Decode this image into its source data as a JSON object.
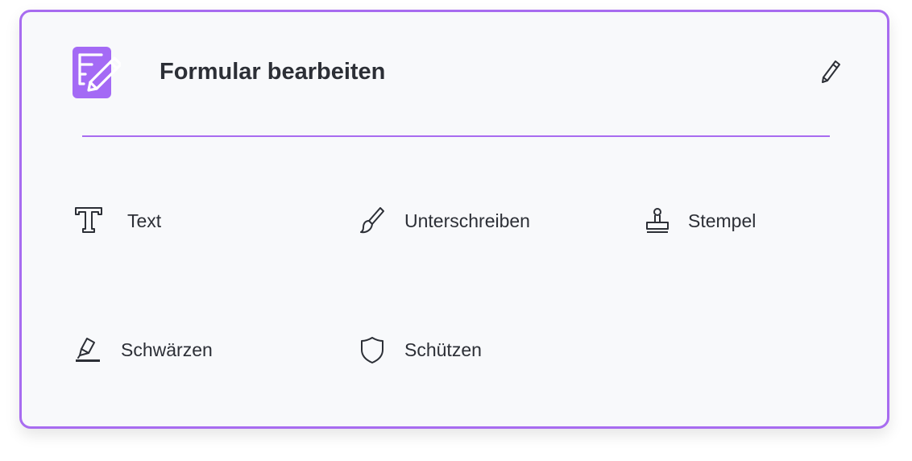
{
  "header": {
    "title": "Formular bearbeiten",
    "app_icon": "form-edit-icon",
    "edit_icon": "pencil-icon"
  },
  "tools": [
    {
      "id": "text",
      "label": "Text",
      "icon": "text-icon"
    },
    {
      "id": "sign",
      "label": "Unterschreiben",
      "icon": "brush-icon"
    },
    {
      "id": "stamp",
      "label": "Stempel",
      "icon": "stamp-icon"
    },
    {
      "id": "redact",
      "label": "Schwärzen",
      "icon": "highlighter-icon"
    },
    {
      "id": "protect",
      "label": "Schützen",
      "icon": "shield-icon"
    }
  ],
  "colors": {
    "accent": "#a86cf0",
    "icon_bg": "#a46af5",
    "text": "#2c2f36",
    "card_bg": "#f8f9fb"
  }
}
